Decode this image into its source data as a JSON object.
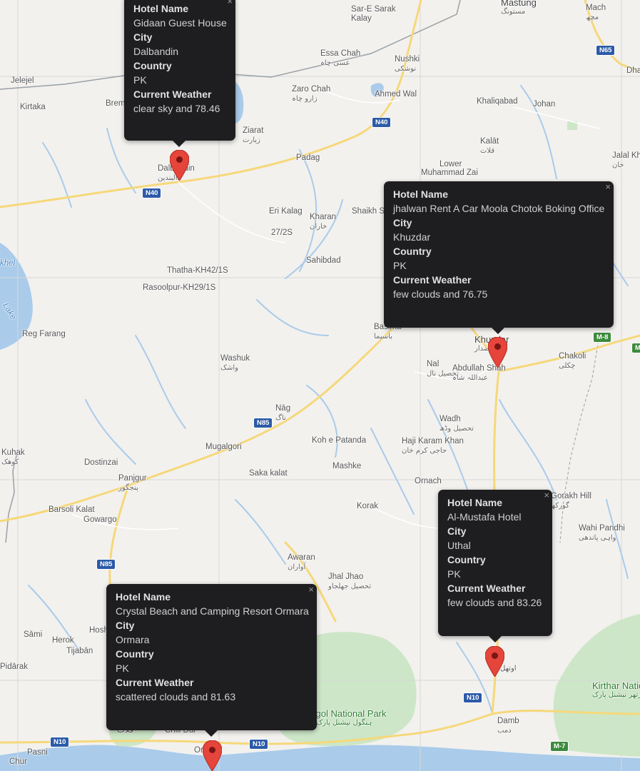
{
  "map": {
    "places": [
      {
        "name": "Sar-E Sarak",
        "urdu": "Kalay"
      },
      {
        "name": "Mastung",
        "urdu": "مستونگ"
      },
      {
        "name": "Mach",
        "urdu": "مچھ"
      },
      {
        "name": "Dha",
        "urdu": ""
      },
      {
        "name": "Jelejel",
        "urdu": ""
      },
      {
        "name": "Kirtaka",
        "urdu": ""
      },
      {
        "name": "Brem",
        "urdu": ""
      },
      {
        "name": "Essa Chah",
        "urdu": "عسی چاہ"
      },
      {
        "name": "Nushki",
        "urdu": "نوشکی"
      },
      {
        "name": "Zaro Chah",
        "urdu": "زارو چاہ"
      },
      {
        "name": "Ahmed Wal",
        "urdu": ""
      },
      {
        "name": "Khaliqabad",
        "urdu": ""
      },
      {
        "name": "Johan",
        "urdu": ""
      },
      {
        "name": "Ziarat",
        "urdu": "زیارت"
      },
      {
        "name": "Kalāt",
        "urdu": "قلات"
      },
      {
        "name": "Padag",
        "urdu": ""
      },
      {
        "name": "Lower",
        "urdu": ""
      },
      {
        "name": "Muhammad Zai",
        "urdu": ""
      },
      {
        "name": "Jalal Kh",
        "urdu": "خان"
      },
      {
        "name": "Dalbandin",
        "urdu": "دالبندین"
      },
      {
        "name": "Eri Kalag",
        "urdu": ""
      },
      {
        "name": "Kharan",
        "urdu": "خاران"
      },
      {
        "name": "Shaikh S",
        "urdu": ""
      },
      {
        "name": "27/2S",
        "urdu": ""
      },
      {
        "name": "Sahibdad",
        "urdu": ""
      },
      {
        "name": "Thatha-KH42/1S",
        "urdu": ""
      },
      {
        "name": "Rasoolpur-KH29/1S",
        "urdu": ""
      },
      {
        "name": "Reg Farang",
        "urdu": ""
      },
      {
        "name": "Basima",
        "urdu": "باسیما"
      },
      {
        "name": "Khuzdar",
        "urdu": "خضدار"
      },
      {
        "name": "Nal",
        "urdu": "تحصیل نال"
      },
      {
        "name": "Abdullah Shah",
        "urdu": "عبداللہ شاہ"
      },
      {
        "name": "Chakoli",
        "urdu": "چکلی"
      },
      {
        "name": "Washuk",
        "urdu": "واشک"
      },
      {
        "name": "Nāg",
        "urdu": "ناگ"
      },
      {
        "name": "Wadh",
        "urdu": "تحصیل وڈھ"
      },
      {
        "name": "Kuhak",
        "urdu": "کوھک"
      },
      {
        "name": "Dostinzai",
        "urdu": ""
      },
      {
        "name": "Mugalgori",
        "urdu": ""
      },
      {
        "name": "Koh e Patanda",
        "urdu": ""
      },
      {
        "name": "Haji Karam Khan",
        "urdu": "حاجی کرم خان"
      },
      {
        "name": "Panjgur",
        "urdu": "پنجگور"
      },
      {
        "name": "Saka kalat",
        "urdu": ""
      },
      {
        "name": "Mashke",
        "urdu": ""
      },
      {
        "name": "Ornach",
        "urdu": ""
      },
      {
        "name": "Gorakh Hill",
        "urdu": "گورکھ"
      },
      {
        "name": "Barsoli Kalat",
        "urdu": ""
      },
      {
        "name": "Gowargo",
        "urdu": ""
      },
      {
        "name": "Korak",
        "urdu": ""
      },
      {
        "name": "Wahi Pandhi",
        "urdu": "واہی پاندھی"
      },
      {
        "name": "Awaran",
        "urdu": "آواران"
      },
      {
        "name": "Jhal Jhao",
        "urdu": "تحصیل جھلجاو"
      },
      {
        "name": "Sāmi",
        "urdu": ""
      },
      {
        "name": "Herok",
        "urdu": ""
      },
      {
        "name": "Hosh",
        "urdu": ""
      },
      {
        "name": "Tijabān",
        "urdu": ""
      },
      {
        "name": "Pidārak",
        "urdu": ""
      },
      {
        "name": "Uthal",
        "urdu": "اوتھل"
      },
      {
        "name": "Hingol National Park",
        "urdu": "ہنگول نیشنل پارک"
      },
      {
        "name": "Kirthar National P",
        "urdu": "کیرتھر نیشنل پارک"
      },
      {
        "name": "Damb",
        "urdu": "دمب"
      },
      {
        "name": "Pasni",
        "urdu": "پسنی"
      },
      {
        "name": "Chur",
        "urdu": ""
      },
      {
        "name": "Kalat",
        "urdu": "قلات"
      },
      {
        "name": "Chill Dar",
        "urdu": ""
      },
      {
        "name": "Ormara",
        "urdu": "اورماڑہ"
      }
    ],
    "water_labels": [
      "khel",
      "Lake"
    ],
    "highway_shields": [
      "N65",
      "N40",
      "N40",
      "N85",
      "N85",
      "N10",
      "N10",
      "N10",
      "M-8",
      "M-7",
      "M"
    ],
    "marker_color": "#e5453b"
  },
  "info_windows": [
    {
      "hotel_label": "Hotel Name",
      "hotel": "Gidaan Guest House",
      "city_label": "City",
      "city": "Dalbandin",
      "country_label": "Country",
      "country": "PK",
      "weather_label": "Current Weather",
      "weather": "clear sky and 78.46",
      "close": "×"
    },
    {
      "hotel_label": "Hotel Name",
      "hotel": "jhalwan Rent A Car Moola Chotok Boking Office",
      "city_label": "City",
      "city": "Khuzdar",
      "country_label": "Country",
      "country": "PK",
      "weather_label": "Current Weather",
      "weather": "few clouds and 76.75",
      "close": "×"
    },
    {
      "hotel_label": "Hotel Name",
      "hotel": "Al-Mustafa Hotel",
      "city_label": "City",
      "city": "Uthal",
      "country_label": "Country",
      "country": "PK",
      "weather_label": "Current Weather",
      "weather": "few clouds and 83.26",
      "close": "×"
    },
    {
      "hotel_label": "Hotel Name",
      "hotel": "Crystal Beach and Camping Resort Ormara",
      "city_label": "City",
      "city": "Ormara",
      "country_label": "Country",
      "country": "PK",
      "weather_label": "Current Weather",
      "weather": "scattered clouds and 81.63",
      "close": "×"
    }
  ]
}
